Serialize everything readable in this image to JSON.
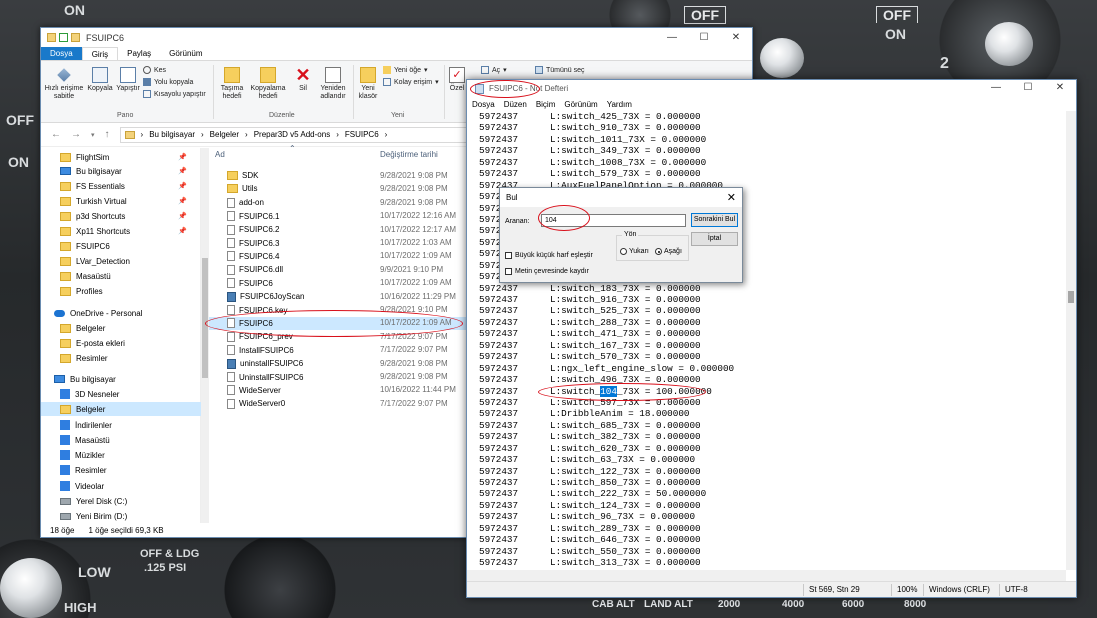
{
  "cockpit": {
    "off_left": "ON",
    "off_right": "OFF",
    "off_right2": "OFF",
    "on_right2": "ON",
    "num": "2",
    "left_side": [
      "OFF",
      "ON"
    ],
    "low": "LOW",
    "high": "HIGH",
    "take_off": "OFF & LDG",
    "psi": ".125 PSI",
    "strip_labels": [
      "CAB ALT",
      "LAND ALT",
      "2000",
      "4000",
      "6000",
      "8000"
    ]
  },
  "explorer": {
    "title": "FSUIPC6",
    "window_controls": [
      "—",
      "☐",
      "✕"
    ],
    "tabs": [
      "Dosya",
      "Giriş",
      "Paylaş",
      "Görünüm"
    ],
    "ribbon": {
      "pin_quick": "Hızlı erişime sabitle",
      "copy": "Kopyala",
      "paste": "Yapıştır",
      "cut": "Kes",
      "copy_path": "Yolu kopyala",
      "paste_shortcut": "Kısayolu yapıştır",
      "move_to": "Taşıma hedefi",
      "copy_to": "Kopyalama hedefi",
      "delete": "Sil",
      "rename": "Yeniden adlandır",
      "new_folder": "Yeni klasör",
      "new_item": "Yeni öğe",
      "easy_access": "Kolay erişim",
      "properties": "Özel",
      "open": "Aç",
      "select_all": "Tümünü seç",
      "group_clipboard": "Pano",
      "group_organize": "Düzenle",
      "group_new": "Yeni"
    },
    "breadcrumb": [
      "Bu bilgisayar",
      "Belgeler",
      "Prepar3D v5 Add-ons",
      "FSUIPC6"
    ],
    "nav": [
      {
        "label": "FlightSim",
        "icon": "folder",
        "pin": true
      },
      {
        "label": "Bu bilgisayar",
        "icon": "pc",
        "pin": true
      },
      {
        "label": "FS Essentials",
        "icon": "folder",
        "pin": true
      },
      {
        "label": "Turkish Virtual",
        "icon": "folder",
        "pin": true
      },
      {
        "label": "p3d Shortcuts",
        "icon": "folder",
        "pin": true
      },
      {
        "label": "Xp11 Shortcuts",
        "icon": "folder",
        "pin": true
      },
      {
        "label": "FSUIPC6",
        "icon": "folder",
        "pin": false
      },
      {
        "label": "LVar_Detection",
        "icon": "folder",
        "pin": false
      },
      {
        "label": "Masaüstü",
        "icon": "folder",
        "pin": false
      },
      {
        "label": "Profiles",
        "icon": "folder",
        "pin": false
      },
      {
        "label": "OneDrive - Personal",
        "icon": "cloud",
        "pin": false
      },
      {
        "label": "Belgeler",
        "icon": "folder",
        "pin": false
      },
      {
        "label": "E-posta ekleri",
        "icon": "folder",
        "pin": false
      },
      {
        "label": "Resimler",
        "icon": "folder",
        "pin": false
      },
      {
        "label": "Bu bilgisayar",
        "icon": "pc",
        "pin": false
      },
      {
        "label": "3D Nesneler",
        "icon": "blue",
        "pin": false
      },
      {
        "label": "Belgeler",
        "icon": "folder",
        "pin": false
      },
      {
        "label": "İndirilenler",
        "icon": "blue",
        "pin": false
      },
      {
        "label": "Masaüstü",
        "icon": "blue",
        "pin": false
      },
      {
        "label": "Müzikler",
        "icon": "blue",
        "pin": false
      },
      {
        "label": "Resimler",
        "icon": "blue",
        "pin": false
      },
      {
        "label": "Videolar",
        "icon": "blue",
        "pin": false
      },
      {
        "label": "Yerel Disk (C:)",
        "icon": "drive",
        "pin": false
      },
      {
        "label": "Yeni Birim (D:)",
        "icon": "drive",
        "pin": false
      }
    ],
    "columns": {
      "name": "Ad",
      "date": "Değiştirme tarihi"
    },
    "files": [
      {
        "name": "SDK",
        "date": "9/28/2021 9:08 PM",
        "icon": "folder"
      },
      {
        "name": "Utils",
        "date": "9/28/2021 9:08 PM",
        "icon": "folder"
      },
      {
        "name": "add-on",
        "date": "9/28/2021 9:08 PM",
        "icon": "file"
      },
      {
        "name": "FSUIPC6.1",
        "date": "10/17/2022 12:16 AM",
        "icon": "file"
      },
      {
        "name": "FSUIPC6.2",
        "date": "10/17/2022 12:17 AM",
        "icon": "file"
      },
      {
        "name": "FSUIPC6.3",
        "date": "10/17/2022 1:03 AM",
        "icon": "file"
      },
      {
        "name": "FSUIPC6.4",
        "date": "10/17/2022 1:09 AM",
        "icon": "file"
      },
      {
        "name": "FSUIPC6.dll",
        "date": "9/9/2021 9:10 PM",
        "icon": "file"
      },
      {
        "name": "FSUIPC6",
        "date": "10/17/2022 1:09 AM",
        "icon": "file"
      },
      {
        "name": "FSUIPC6JoyScan",
        "date": "10/16/2022 11:29 PM",
        "icon": "app"
      },
      {
        "name": "FSUIPC6.key",
        "date": "9/28/2021 9:10 PM",
        "icon": "file"
      },
      {
        "name": "FSUIPC6",
        "date": "10/17/2022 1:09 AM",
        "icon": "file",
        "selected": true
      },
      {
        "name": "FSUIPC6_prev",
        "date": "7/17/2022 9:07 PM",
        "icon": "file"
      },
      {
        "name": "InstallFSUIPC6",
        "date": "7/17/2022 9:07 PM",
        "icon": "file"
      },
      {
        "name": "uninstallFSUIPC6",
        "date": "9/28/2021 9:08 PM",
        "icon": "app"
      },
      {
        "name": "UninstallFSUIPC6",
        "date": "9/28/2021 9:08 PM",
        "icon": "file"
      },
      {
        "name": "WideServer",
        "date": "10/16/2022 11:44 PM",
        "icon": "file"
      },
      {
        "name": "WideServer0",
        "date": "7/17/2022 9:07 PM",
        "icon": "file"
      }
    ],
    "status": {
      "count": "18 öğe",
      "selected": "1 öğe seçildi  69,3 KB"
    }
  },
  "notepad": {
    "title": "FSUIPC6 - Not Defteri",
    "window_controls": [
      "—",
      "☐",
      "✕"
    ],
    "menu": [
      "Dosya",
      "Düzen",
      "Biçim",
      "Görünüm",
      "Yardım"
    ],
    "lines": [
      {
        "n": "5972437",
        "t": "L:switch_425_73X = 0.000000"
      },
      {
        "n": "5972437",
        "t": "L:switch_910_73X = 0.000000"
      },
      {
        "n": "5972437",
        "t": "L:switch_1011_73X = 0.000000"
      },
      {
        "n": "5972437",
        "t": "L:switch_349_73X = 0.000000"
      },
      {
        "n": "5972437",
        "t": "L:switch_1008_73X = 0.000000"
      },
      {
        "n": "5972437",
        "t": "L:switch_579_73X = 0.000000"
      },
      {
        "n": "5972437",
        "t": "L:AuxFuelPanelOption = 0.000000"
      },
      {
        "n": "5972437",
        "t": ""
      },
      {
        "n": "5972437",
        "t": ""
      },
      {
        "n": "5972437",
        "t": ""
      },
      {
        "n": "5972437",
        "t": ""
      },
      {
        "n": "5972437",
        "t": ""
      },
      {
        "n": "5972437",
        "t": ""
      },
      {
        "n": "5972437",
        "t": ""
      },
      {
        "n": "5972437",
        "t": ""
      },
      {
        "n": "5972437",
        "t": "L:switch_183_73X = 0.000000"
      },
      {
        "n": "5972437",
        "t": "L:switch_916_73X = 0.000000"
      },
      {
        "n": "5972437",
        "t": "L:switch_525_73X = 0.000000"
      },
      {
        "n": "5972437",
        "t": "L:switch_288_73X = 0.000000"
      },
      {
        "n": "5972437",
        "t": "L:switch_471_73X = 0.000000"
      },
      {
        "n": "5972437",
        "t": "L:switch_167_73X = 0.000000"
      },
      {
        "n": "5972437",
        "t": "L:switch_570_73X = 0.000000"
      },
      {
        "n": "5972437",
        "t": "L:ngx_left_engine_slow = 0.000000"
      },
      {
        "n": "5972437",
        "t": "L:switch_496_73X = 0.000000"
      },
      {
        "n": "5972437",
        "pre": "L:switch_",
        "hl": "104",
        "post": "_73X = 100.000000"
      },
      {
        "n": "5972437",
        "t": "L:switch_597_73X = 0.000000"
      },
      {
        "n": "5972437",
        "t": "L:DribbleAnim = 18.000000"
      },
      {
        "n": "5972437",
        "t": "L:switch_685_73X = 0.000000"
      },
      {
        "n": "5972437",
        "t": "L:switch_382_73X = 0.000000"
      },
      {
        "n": "5972437",
        "t": "L:switch_620_73X = 0.000000"
      },
      {
        "n": "5972437",
        "t": "L:switch_63_73X = 0.000000"
      },
      {
        "n": "5972437",
        "t": "L:switch_122_73X = 0.000000"
      },
      {
        "n": "5972437",
        "t": "L:switch_850_73X = 0.000000"
      },
      {
        "n": "5972437",
        "t": "L:switch_222_73X = 50.000000"
      },
      {
        "n": "5972437",
        "t": "L:switch_124_73X = 0.000000"
      },
      {
        "n": "5972437",
        "t": "L:switch_96_73X = 0.000000"
      },
      {
        "n": "5972437",
        "t": "L:switch_289_73X = 0.000000"
      },
      {
        "n": "5972437",
        "t": "L:switch_646_73X = 0.000000"
      },
      {
        "n": "5972437",
        "t": "L:switch_550_73X = 0.000000"
      },
      {
        "n": "5972437",
        "t": "L:switch_313_73X = 0.000000"
      }
    ],
    "status": {
      "pos": "St 569, Stn 29",
      "zoom": "100%",
      "eol": "Windows (CRLF)",
      "enc": "UTF-8"
    }
  },
  "find": {
    "title": "Bul",
    "label": "Aranan:",
    "value": "104",
    "find_next": "Sonrakini Bul",
    "cancel": "İptal",
    "direction": "Yön",
    "up": "Yukarı",
    "down": "Aşağı",
    "match_case": "Büyük küçük harf eşleştir",
    "wrap": "Metin çevresinde kaydır"
  }
}
